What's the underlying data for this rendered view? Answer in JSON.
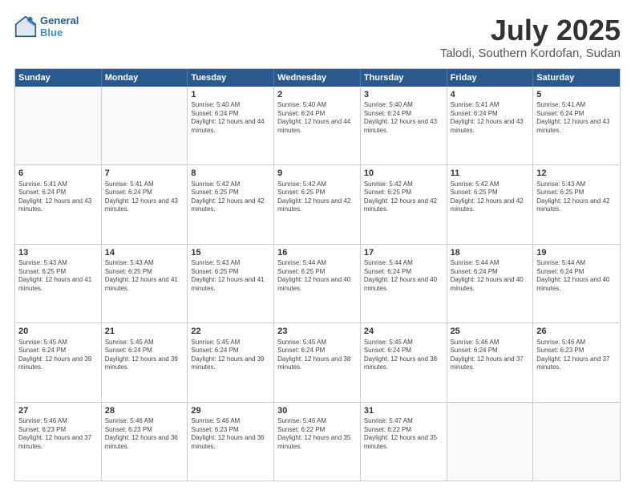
{
  "logo": {
    "line1": "General",
    "line2": "Blue"
  },
  "title": "July 2025",
  "location": "Talodi, Southern Kordofan, Sudan",
  "days_of_week": [
    "Sunday",
    "Monday",
    "Tuesday",
    "Wednesday",
    "Thursday",
    "Friday",
    "Saturday"
  ],
  "weeks": [
    [
      {
        "day": "",
        "info": "",
        "empty": true
      },
      {
        "day": "",
        "info": "",
        "empty": true
      },
      {
        "day": "1",
        "info": "Sunrise: 5:40 AM\nSunset: 6:24 PM\nDaylight: 12 hours and 44 minutes."
      },
      {
        "day": "2",
        "info": "Sunrise: 5:40 AM\nSunset: 6:24 PM\nDaylight: 12 hours and 44 minutes."
      },
      {
        "day": "3",
        "info": "Sunrise: 5:40 AM\nSunset: 6:24 PM\nDaylight: 12 hours and 43 minutes."
      },
      {
        "day": "4",
        "info": "Sunrise: 5:41 AM\nSunset: 6:24 PM\nDaylight: 12 hours and 43 minutes."
      },
      {
        "day": "5",
        "info": "Sunrise: 5:41 AM\nSunset: 6:24 PM\nDaylight: 12 hours and 43 minutes."
      }
    ],
    [
      {
        "day": "6",
        "info": "Sunrise: 5:41 AM\nSunset: 6:24 PM\nDaylight: 12 hours and 43 minutes."
      },
      {
        "day": "7",
        "info": "Sunrise: 5:41 AM\nSunset: 6:24 PM\nDaylight: 12 hours and 43 minutes."
      },
      {
        "day": "8",
        "info": "Sunrise: 5:42 AM\nSunset: 6:25 PM\nDaylight: 12 hours and 42 minutes."
      },
      {
        "day": "9",
        "info": "Sunrise: 5:42 AM\nSunset: 6:25 PM\nDaylight: 12 hours and 42 minutes."
      },
      {
        "day": "10",
        "info": "Sunrise: 5:42 AM\nSunset: 6:25 PM\nDaylight: 12 hours and 42 minutes."
      },
      {
        "day": "11",
        "info": "Sunrise: 5:42 AM\nSunset: 6:25 PM\nDaylight: 12 hours and 42 minutes."
      },
      {
        "day": "12",
        "info": "Sunrise: 5:43 AM\nSunset: 6:25 PM\nDaylight: 12 hours and 42 minutes."
      }
    ],
    [
      {
        "day": "13",
        "info": "Sunrise: 5:43 AM\nSunset: 6:25 PM\nDaylight: 12 hours and 41 minutes."
      },
      {
        "day": "14",
        "info": "Sunrise: 5:43 AM\nSunset: 6:25 PM\nDaylight: 12 hours and 41 minutes."
      },
      {
        "day": "15",
        "info": "Sunrise: 5:43 AM\nSunset: 6:25 PM\nDaylight: 12 hours and 41 minutes."
      },
      {
        "day": "16",
        "info": "Sunrise: 5:44 AM\nSunset: 6:25 PM\nDaylight: 12 hours and 40 minutes."
      },
      {
        "day": "17",
        "info": "Sunrise: 5:44 AM\nSunset: 6:24 PM\nDaylight: 12 hours and 40 minutes."
      },
      {
        "day": "18",
        "info": "Sunrise: 5:44 AM\nSunset: 6:24 PM\nDaylight: 12 hours and 40 minutes."
      },
      {
        "day": "19",
        "info": "Sunrise: 5:44 AM\nSunset: 6:24 PM\nDaylight: 12 hours and 40 minutes."
      }
    ],
    [
      {
        "day": "20",
        "info": "Sunrise: 5:45 AM\nSunset: 6:24 PM\nDaylight: 12 hours and 39 minutes."
      },
      {
        "day": "21",
        "info": "Sunrise: 5:45 AM\nSunset: 6:24 PM\nDaylight: 12 hours and 39 minutes."
      },
      {
        "day": "22",
        "info": "Sunrise: 5:45 AM\nSunset: 6:24 PM\nDaylight: 12 hours and 39 minutes."
      },
      {
        "day": "23",
        "info": "Sunrise: 5:45 AM\nSunset: 6:24 PM\nDaylight: 12 hours and 38 minutes."
      },
      {
        "day": "24",
        "info": "Sunrise: 5:45 AM\nSunset: 6:24 PM\nDaylight: 12 hours and 38 minutes."
      },
      {
        "day": "25",
        "info": "Sunrise: 5:46 AM\nSunset: 6:24 PM\nDaylight: 12 hours and 37 minutes."
      },
      {
        "day": "26",
        "info": "Sunrise: 5:46 AM\nSunset: 6:23 PM\nDaylight: 12 hours and 37 minutes."
      }
    ],
    [
      {
        "day": "27",
        "info": "Sunrise: 5:46 AM\nSunset: 6:23 PM\nDaylight: 12 hours and 37 minutes."
      },
      {
        "day": "28",
        "info": "Sunrise: 5:46 AM\nSunset: 6:23 PM\nDaylight: 12 hours and 36 minutes."
      },
      {
        "day": "29",
        "info": "Sunrise: 5:46 AM\nSunset: 6:23 PM\nDaylight: 12 hours and 36 minutes."
      },
      {
        "day": "30",
        "info": "Sunrise: 5:46 AM\nSunset: 6:22 PM\nDaylight: 12 hours and 35 minutes."
      },
      {
        "day": "31",
        "info": "Sunrise: 5:47 AM\nSunset: 6:22 PM\nDaylight: 12 hours and 35 minutes."
      },
      {
        "day": "",
        "info": "",
        "empty": true
      },
      {
        "day": "",
        "info": "",
        "empty": true
      }
    ]
  ]
}
